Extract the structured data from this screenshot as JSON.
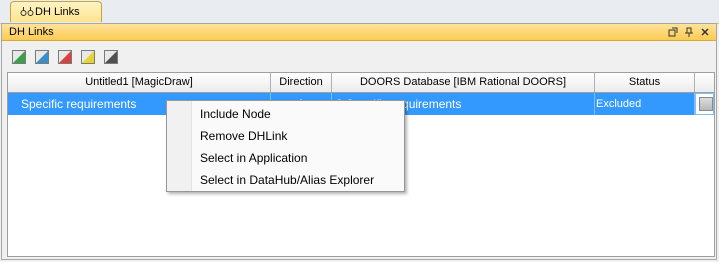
{
  "tab": {
    "label": "DH Links",
    "icon": "links-icon"
  },
  "panel": {
    "title": "DH Links",
    "controls": [
      "restore-icon",
      "pin-icon",
      "close-icon"
    ]
  },
  "toolbar": {
    "buttons": [
      {
        "name": "green-flag-icon",
        "color": "#3aa04a"
      },
      {
        "name": "blue-flag-icon",
        "color": "#3b8fc9"
      },
      {
        "name": "red-flag-icon",
        "color": "#d94040"
      },
      {
        "name": "yellow-flag-icon",
        "color": "#e6d530"
      },
      {
        "name": "dark-flag-icon",
        "color": "#505050"
      }
    ]
  },
  "table": {
    "headers": [
      "Untitled1 [MagicDraw]",
      "Direction",
      "DOORS Database [IBM Rational DOORS]",
      "Status",
      ""
    ],
    "rows": [
      {
        "source": "Specific requirements",
        "direction": "A",
        "target": "3 Specific requirements",
        "status": "Excluded"
      }
    ]
  },
  "context_menu": {
    "items": [
      "Include Node",
      "Remove DHLink",
      "Select in Application",
      "Select in DataHub/Alias Explorer"
    ]
  },
  "colors": {
    "selection": "#3399ff",
    "title_bar": "#fbcb52",
    "tab": "#fde58d"
  }
}
